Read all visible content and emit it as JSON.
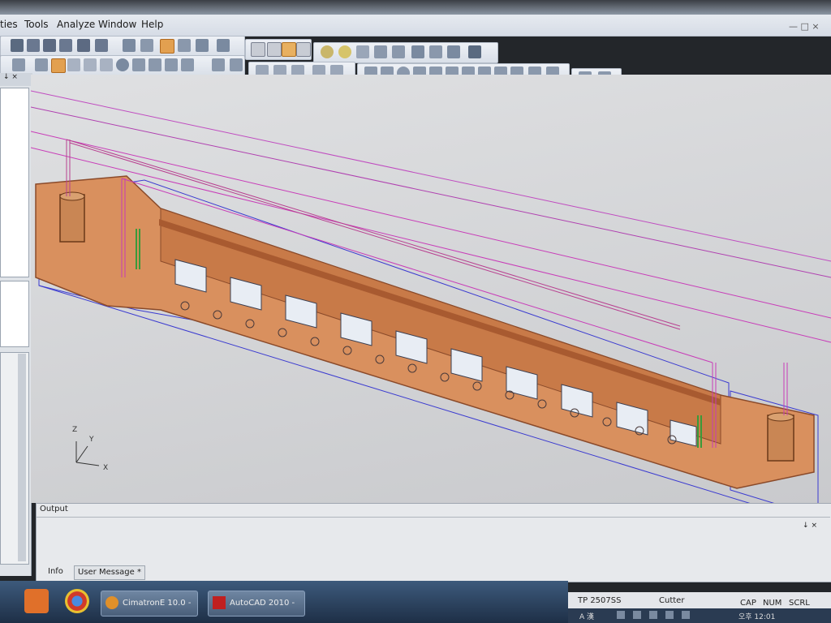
{
  "menu": {
    "items": [
      "ties",
      "Tools",
      "Analyze",
      "Window",
      "Help"
    ]
  },
  "window_controls": "—  □  ×",
  "viewport": {
    "axes": {
      "z": "Z",
      "y": "Y",
      "x": "X"
    }
  },
  "output_panel": {
    "title": "Output",
    "pin": "↓ ×",
    "tabs": [
      "Info",
      "User Message *"
    ]
  },
  "statusbar": {
    "tp": "TP  2507SS",
    "tool": "Cutter",
    "cap": "CAP",
    "num": "NUM",
    "scrl": "SCRL"
  },
  "taskbar": {
    "apps": [
      {
        "label": "CimatronE 10.0 -"
      },
      {
        "label": "AutoCAD 2010 -"
      }
    ]
  },
  "tray": {
    "ime": "A 漢",
    "clock": "오후 12:01"
  },
  "colors": {
    "part": "#d9905e",
    "part_edge": "#8a4a2a",
    "toolpath": "#c83cb8",
    "bbox": "#3a3ad0",
    "viewport_bg": "#d6d7d9"
  }
}
